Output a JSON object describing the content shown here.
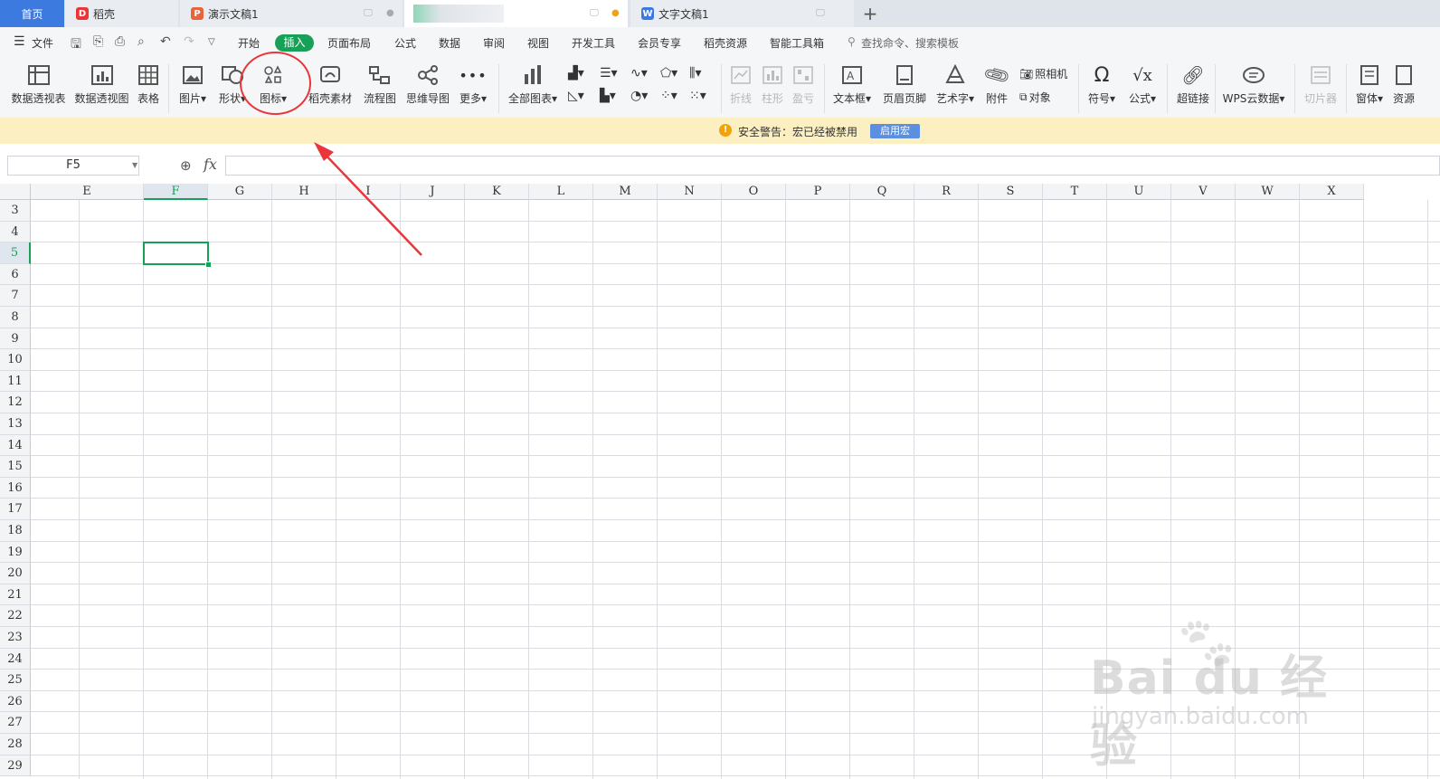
{
  "tabs": {
    "home": "首页",
    "daoke": "稻壳",
    "presentation": "演示文稿1",
    "blurred": "",
    "document": "文字文稿1",
    "add": "+"
  },
  "menu": {
    "file": "文件",
    "items": [
      "开始",
      "插入",
      "页面布局",
      "公式",
      "数据",
      "审阅",
      "视图",
      "开发工具",
      "会员专享",
      "稻壳资源",
      "智能工具箱"
    ],
    "search_placeholder": "查找命令、搜索模板"
  },
  "ribbon": {
    "pivot_table": "数据透视表",
    "pivot_chart": "数据透视图",
    "table": "表格",
    "picture": "图片",
    "shape": "形状",
    "icon": "图标",
    "daoke_material": "稻壳素材",
    "flowchart": "流程图",
    "mind_map": "思维导图",
    "more": "更多",
    "all_charts": "全部图表",
    "sparkline_line": "折线",
    "sparkline_column": "柱形",
    "sparkline_winloss": "盈亏",
    "text_box": "文本框",
    "header_footer": "页眉页脚",
    "word_art": "艺术字",
    "attachment": "附件",
    "camera": "照相机",
    "object": "对象",
    "symbol": "符号",
    "formula": "公式",
    "hyperlink": "超链接",
    "wps_cloud_data": "WPS云数据",
    "slicer": "切片器",
    "form": "窗体",
    "resources": "资源"
  },
  "warning": {
    "text": "安全警告：宏已经被禁用",
    "button": "启用宏"
  },
  "formula_bar": {
    "name_box": "F5",
    "fx": "fx",
    "value": ""
  },
  "sheet": {
    "columns": [
      "E",
      "F",
      "G",
      "H",
      "I",
      "J",
      "K",
      "L",
      "M",
      "N",
      "O",
      "P",
      "Q",
      "R",
      "S",
      "T",
      "U",
      "V",
      "W",
      "X"
    ],
    "rows": [
      "3",
      "4",
      "5",
      "6",
      "7",
      "8",
      "9",
      "10",
      "11",
      "12",
      "13",
      "14",
      "15",
      "16",
      "17",
      "18",
      "19",
      "20",
      "21",
      "22",
      "23",
      "24",
      "25",
      "26",
      "27",
      "28",
      "29"
    ],
    "selected_column": "F",
    "selected_row": "5"
  },
  "watermark": {
    "brand": "Bai du 经验",
    "url": "jingyan.baidu.com"
  },
  "colors": {
    "accent_green": "#18a058",
    "tab_blue": "#3d7ae0",
    "annotation_red": "#e8363b",
    "warning_bg": "#fcefc2"
  }
}
